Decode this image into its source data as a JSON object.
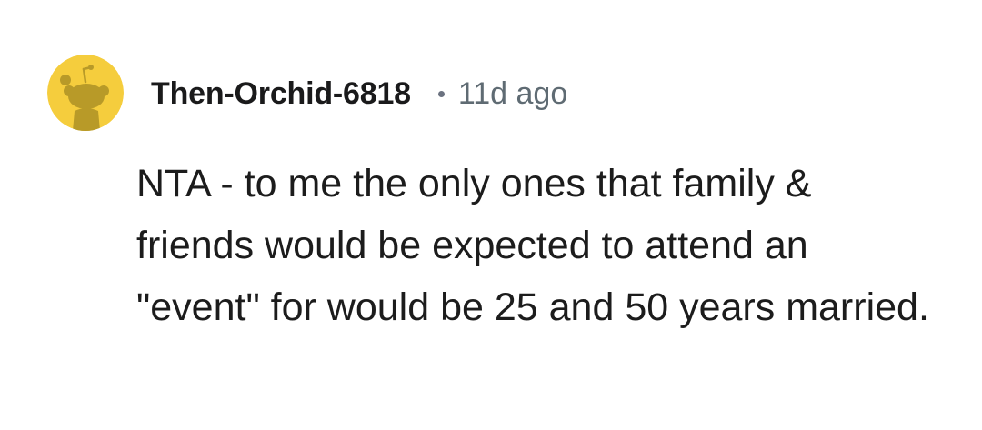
{
  "comment": {
    "author": "Then-Orchid-6818",
    "timestamp": "11d ago",
    "body": "NTA - to me the only ones that family & friends would be expected to attend an \"event\" for would be 25 and 50 years married.",
    "avatar": {
      "icon": "reddit-snoo-avatar-icon",
      "background_color": "#f5cd3d",
      "figure_color": "#b89a28"
    }
  }
}
